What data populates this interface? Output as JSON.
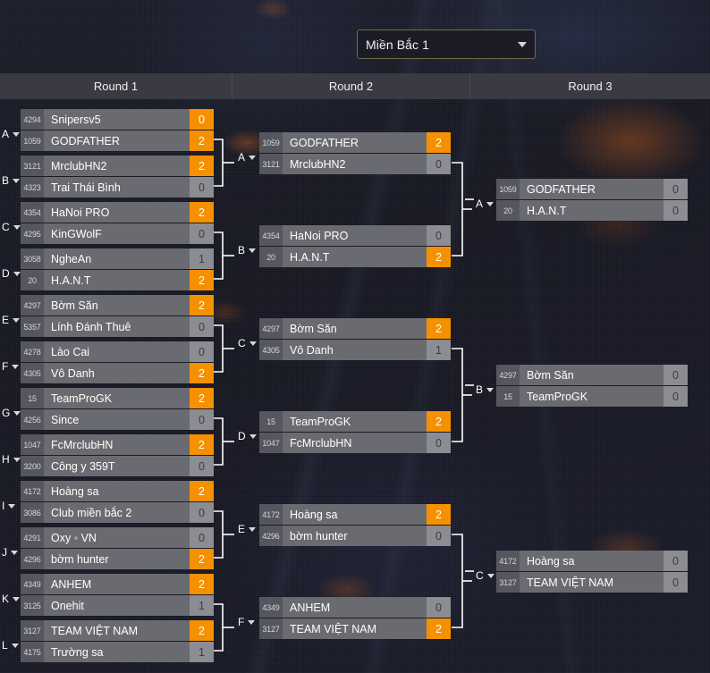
{
  "header": {
    "region_select": {
      "value": "Miền Bắc 1",
      "caret": "chevron-down-icon"
    }
  },
  "rounds": [
    {
      "label": "Round 1"
    },
    {
      "label": "Round 2"
    },
    {
      "label": "Round 3"
    }
  ],
  "colors": {
    "winner_score_bg": "#f59100",
    "team_bg": "#6a6b71",
    "seed_bg": "#55565e",
    "score_bg": "#8c8d92",
    "round_header_bg": "#3a3a42",
    "page_bg": "#14151f",
    "select_border": "#6f6a46"
  },
  "bracket": {
    "round1": [
      {
        "key": "A",
        "teams": [
          {
            "seed": "4294",
            "name": "Snipersv5",
            "score": "0",
            "winner": false
          },
          {
            "seed": "1059",
            "name": "GODFATHER",
            "score": "2",
            "winner": true
          }
        ]
      },
      {
        "key": "B",
        "teams": [
          {
            "seed": "3121",
            "name": "MrclubHN2",
            "score": "2",
            "winner": true
          },
          {
            "seed": "4323",
            "name": "Trai Thái Bình",
            "score": "0",
            "winner": false
          }
        ]
      },
      {
        "key": "C",
        "teams": [
          {
            "seed": "4354",
            "name": "HaNoi PRO",
            "score": "2",
            "winner": true
          },
          {
            "seed": "4295",
            "name": "KinGWolF",
            "score": "0",
            "winner": false
          }
        ]
      },
      {
        "key": "D",
        "teams": [
          {
            "seed": "3058",
            "name": "NgheAn",
            "score": "1",
            "winner": false
          },
          {
            "seed": "20",
            "name": "H.A.N.T",
            "score": "2",
            "winner": true
          }
        ]
      },
      {
        "key": "E",
        "teams": [
          {
            "seed": "4297",
            "name": "Bờm Săn",
            "score": "2",
            "winner": true
          },
          {
            "seed": "5357",
            "name": "Lính Đánh Thuê",
            "score": "0",
            "winner": false
          }
        ]
      },
      {
        "key": "F",
        "teams": [
          {
            "seed": "4278",
            "name": "Lào Cai",
            "score": "0",
            "winner": false
          },
          {
            "seed": "4305",
            "name": "Vô Danh",
            "score": "2",
            "winner": true
          }
        ]
      },
      {
        "key": "G",
        "teams": [
          {
            "seed": "15",
            "name": "TeamProGK",
            "score": "2",
            "winner": true
          },
          {
            "seed": "4256",
            "name": "Since",
            "score": "0",
            "winner": false
          }
        ]
      },
      {
        "key": "H",
        "teams": [
          {
            "seed": "1047",
            "name": "FcMrclubHN",
            "score": "2",
            "winner": true
          },
          {
            "seed": "3200",
            "name": "Công y 359T",
            "score": "0",
            "winner": false
          }
        ]
      },
      {
        "key": "I",
        "teams": [
          {
            "seed": "4172",
            "name": "Hoàng sa",
            "score": "2",
            "winner": true
          },
          {
            "seed": "3086",
            "name": "Club miền bắc 2",
            "score": "0",
            "winner": false
          }
        ]
      },
      {
        "key": "J",
        "teams": [
          {
            "seed": "4291",
            "name": "Oxy ◦ VN",
            "score": "0",
            "winner": false
          },
          {
            "seed": "4296",
            "name": "bờm hunter",
            "score": "2",
            "winner": true
          }
        ]
      },
      {
        "key": "K",
        "teams": [
          {
            "seed": "4349",
            "name": "ANHEM",
            "score": "2",
            "winner": true
          },
          {
            "seed": "3125",
            "name": "Onehit",
            "score": "1",
            "winner": false
          }
        ]
      },
      {
        "key": "L",
        "teams": [
          {
            "seed": "3127",
            "name": "TEAM VIỆT NAM",
            "score": "2",
            "winner": true
          },
          {
            "seed": "4175",
            "name": "Trường sa",
            "score": "1",
            "winner": false
          }
        ]
      }
    ],
    "round2": [
      {
        "key": "A",
        "teams": [
          {
            "seed": "1059",
            "name": "GODFATHER",
            "score": "2",
            "winner": true
          },
          {
            "seed": "3121",
            "name": "MrclubHN2",
            "score": "0",
            "winner": false
          }
        ]
      },
      {
        "key": "B",
        "teams": [
          {
            "seed": "4354",
            "name": "HaNoi PRO",
            "score": "0",
            "winner": false
          },
          {
            "seed": "20",
            "name": "H.A.N.T",
            "score": "2",
            "winner": true
          }
        ]
      },
      {
        "key": "C",
        "teams": [
          {
            "seed": "4297",
            "name": "Bờm Săn",
            "score": "2",
            "winner": true
          },
          {
            "seed": "4305",
            "name": "Vô Danh",
            "score": "1",
            "winner": false
          }
        ]
      },
      {
        "key": "D",
        "teams": [
          {
            "seed": "15",
            "name": "TeamProGK",
            "score": "2",
            "winner": true
          },
          {
            "seed": "1047",
            "name": "FcMrclubHN",
            "score": "0",
            "winner": false
          }
        ]
      },
      {
        "key": "E",
        "teams": [
          {
            "seed": "4172",
            "name": "Hoàng sa",
            "score": "2",
            "winner": true
          },
          {
            "seed": "4296",
            "name": "bờm hunter",
            "score": "0",
            "winner": false
          }
        ]
      },
      {
        "key": "F",
        "teams": [
          {
            "seed": "4349",
            "name": "ANHEM",
            "score": "0",
            "winner": false
          },
          {
            "seed": "3127",
            "name": "TEAM VIỆT NAM",
            "score": "2",
            "winner": true
          }
        ]
      }
    ],
    "round3": [
      {
        "key": "A",
        "teams": [
          {
            "seed": "1059",
            "name": "GODFATHER",
            "score": "0",
            "winner": false
          },
          {
            "seed": "20",
            "name": "H.A.N.T",
            "score": "0",
            "winner": false
          }
        ]
      },
      {
        "key": "B",
        "teams": [
          {
            "seed": "4297",
            "name": "Bờm Săn",
            "score": "0",
            "winner": false
          },
          {
            "seed": "15",
            "name": "TeamProGK",
            "score": "0",
            "winner": false
          }
        ]
      },
      {
        "key": "C",
        "teams": [
          {
            "seed": "4172",
            "name": "Hoàng sa",
            "score": "0",
            "winner": false
          },
          {
            "seed": "3127",
            "name": "TEAM VIỆT NAM",
            "score": "0",
            "winner": false
          }
        ]
      }
    ]
  }
}
